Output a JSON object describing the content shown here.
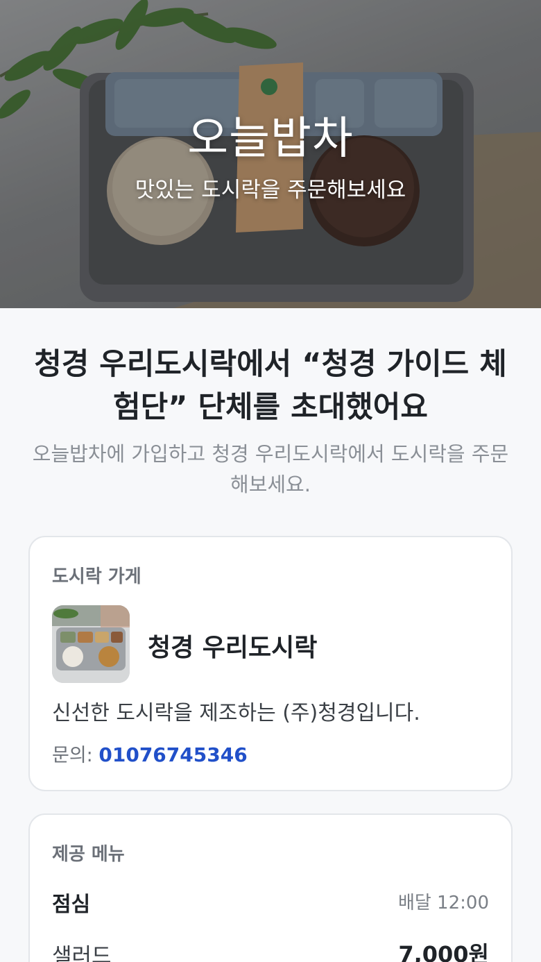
{
  "hero": {
    "title": "오늘밥차",
    "subtitle": "맛있는 도시락을 주문해보세요"
  },
  "intro": {
    "headline": "청경 우리도시락에서 “청경 가이드 체험단” 단체를 초대했어요",
    "subline": "오늘밥차에 가입하고 청경 우리도시락에서 도시락을 주문해보세요."
  },
  "store_card": {
    "label": "도시락 가게",
    "name": "청경 우리도시락",
    "description": "신선한 도시락을 제조하는 (주)청경입니다.",
    "contact_label": "문의:",
    "phone": "01076745346"
  },
  "menu_card": {
    "label": "제공 메뉴",
    "meal": "점심",
    "delivery_time": "배달 12:00",
    "items": [
      {
        "name": "샐러드",
        "price": "7,000원"
      }
    ]
  },
  "colors": {
    "link_blue": "#2150c9",
    "card_border": "#e3e6ea",
    "page_bg": "#f7f8fa"
  }
}
